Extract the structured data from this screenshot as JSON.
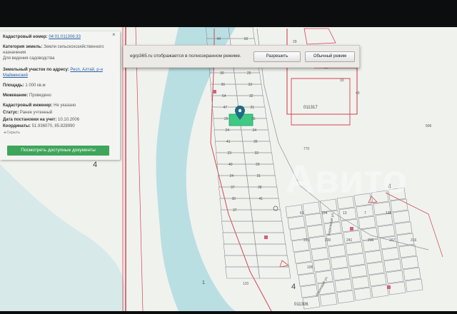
{
  "info_panel": {
    "cadastral_number_label": "Кадастровый номер:",
    "cadastral_number": "04:01:011306:33",
    "category_label": "Категория земель:",
    "category_value_1": "Земли сельскохозяйственного",
    "category_value_2": "назначения",
    "category_value_3": "Для ведения садоводства",
    "address_label": "Земельный участок по адресу:",
    "address_value_1": "Респ. Алтай, р-н",
    "address_value_2": "Майминский",
    "area_label": "Площадь:",
    "area_value": "1 000 кв.м",
    "survey_label": "Межевание:",
    "survey_value": "Проведено",
    "engineer_label": "Кадастровый инженер:",
    "engineer_value": "Не указано",
    "status_label": "Статус:",
    "status_value": "Ранее учтенный",
    "date_label": "Дата постановки на учет:",
    "date_value": "10.10.2006",
    "coords_label": "Координаты:",
    "coords_value": "51.936070, 85.828990",
    "hide_label": "◂ Скрыть",
    "docs_button": "Посмотреть доступные документы",
    "close_glyph": "×"
  },
  "fullscreen_prompt": {
    "message": "egrp365.ru отображается в полноэкранном режиме.",
    "allow_button": "Разрешить",
    "normal_button": "Обычный режим"
  },
  "map": {
    "zone_labels": [
      "4",
      "4",
      "1",
      "4"
    ],
    "block_labels": [
      "011317",
      "011306"
    ],
    "parcel_labels": [
      "44",
      "18",
      "270",
      "28",
      "49",
      "19",
      "30",
      "25",
      "36",
      "33",
      "54",
      "32",
      "47",
      "31",
      "26",
      "35",
      "24",
      "34",
      "41",
      "39",
      "23",
      "33",
      "40",
      "29",
      "24",
      "31",
      "37",
      "38",
      "30",
      "41",
      "37",
      "29",
      "30",
      "25",
      "33",
      "40",
      "61",
      "154",
      "13",
      "7",
      "138",
      "506",
      "220",
      "230",
      "241",
      "236",
      "167",
      "316",
      "106"
    ],
    "road_labels": [
      "Березовая ул.",
      "Сосновая ул."
    ],
    "river_label": "120",
    "misc_label": "770",
    "watermark": "Авито",
    "colors": {
      "map_bg": "#f0f2ee",
      "river": "#b9dfe3",
      "parcel_line": "#8d9096",
      "boundary_red": "#d54450",
      "selected_parcel": "#3fca83",
      "marker": "#1f6c84",
      "button_green": "#3ea55a"
    }
  }
}
